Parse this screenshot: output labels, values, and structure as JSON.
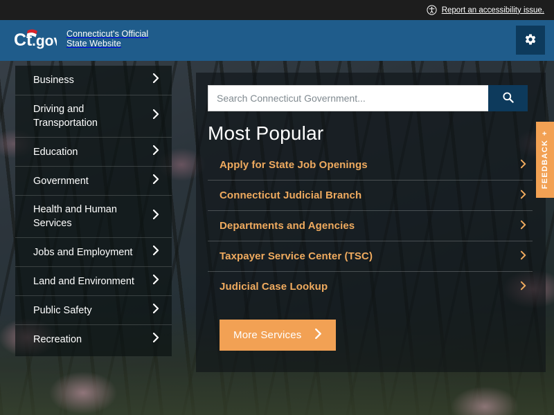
{
  "accessibility_bar": {
    "icon": "accessibility-person-icon",
    "link_label": "Report an accessibility issue.",
    "background_color": "#1d1d1d"
  },
  "header": {
    "logo_text": "Ct.gov",
    "tagline_line1": "Connecticut's Official",
    "tagline_line2": "State Website",
    "settings_icon": "gear-icon",
    "background_color": "#1f5c8b",
    "settings_button_color": "#0d3a5c"
  },
  "sidebar": {
    "items": [
      {
        "label": "Business",
        "icon": "chevron-right-icon"
      },
      {
        "label": "Driving and Transportation",
        "icon": "chevron-right-icon"
      },
      {
        "label": "Education",
        "icon": "chevron-right-icon"
      },
      {
        "label": "Government",
        "icon": "chevron-right-icon"
      },
      {
        "label": "Health and Human Services",
        "icon": "chevron-right-icon"
      },
      {
        "label": "Jobs and Employment",
        "icon": "chevron-right-icon"
      },
      {
        "label": "Land and Environment",
        "icon": "chevron-right-icon"
      },
      {
        "label": "Public Safety",
        "icon": "chevron-right-icon"
      },
      {
        "label": "Recreation",
        "icon": "chevron-right-icon"
      }
    ]
  },
  "search": {
    "placeholder": "Search Connecticut Government...",
    "value": "",
    "button_icon": "search-icon"
  },
  "main": {
    "title": "Most Popular",
    "popular_links": [
      {
        "label": "Apply for State Job Openings",
        "icon": "chevron-right-icon"
      },
      {
        "label": "Connecticut Judicial Branch",
        "icon": "chevron-right-icon"
      },
      {
        "label": "Departments and Agencies",
        "icon": "chevron-right-icon"
      },
      {
        "label": "Taxpayer Service Center (TSC)",
        "icon": "chevron-right-icon"
      },
      {
        "label": "Judicial Case Lookup",
        "icon": "chevron-right-icon"
      }
    ],
    "more_button_label": "More Services",
    "more_button_icon": "chevron-right-icon",
    "link_color": "#f0ab5f",
    "button_color": "#f2a154"
  },
  "feedback": {
    "label": "FEEDBACK",
    "plus_icon": "plus-icon",
    "color": "#f2a154"
  }
}
